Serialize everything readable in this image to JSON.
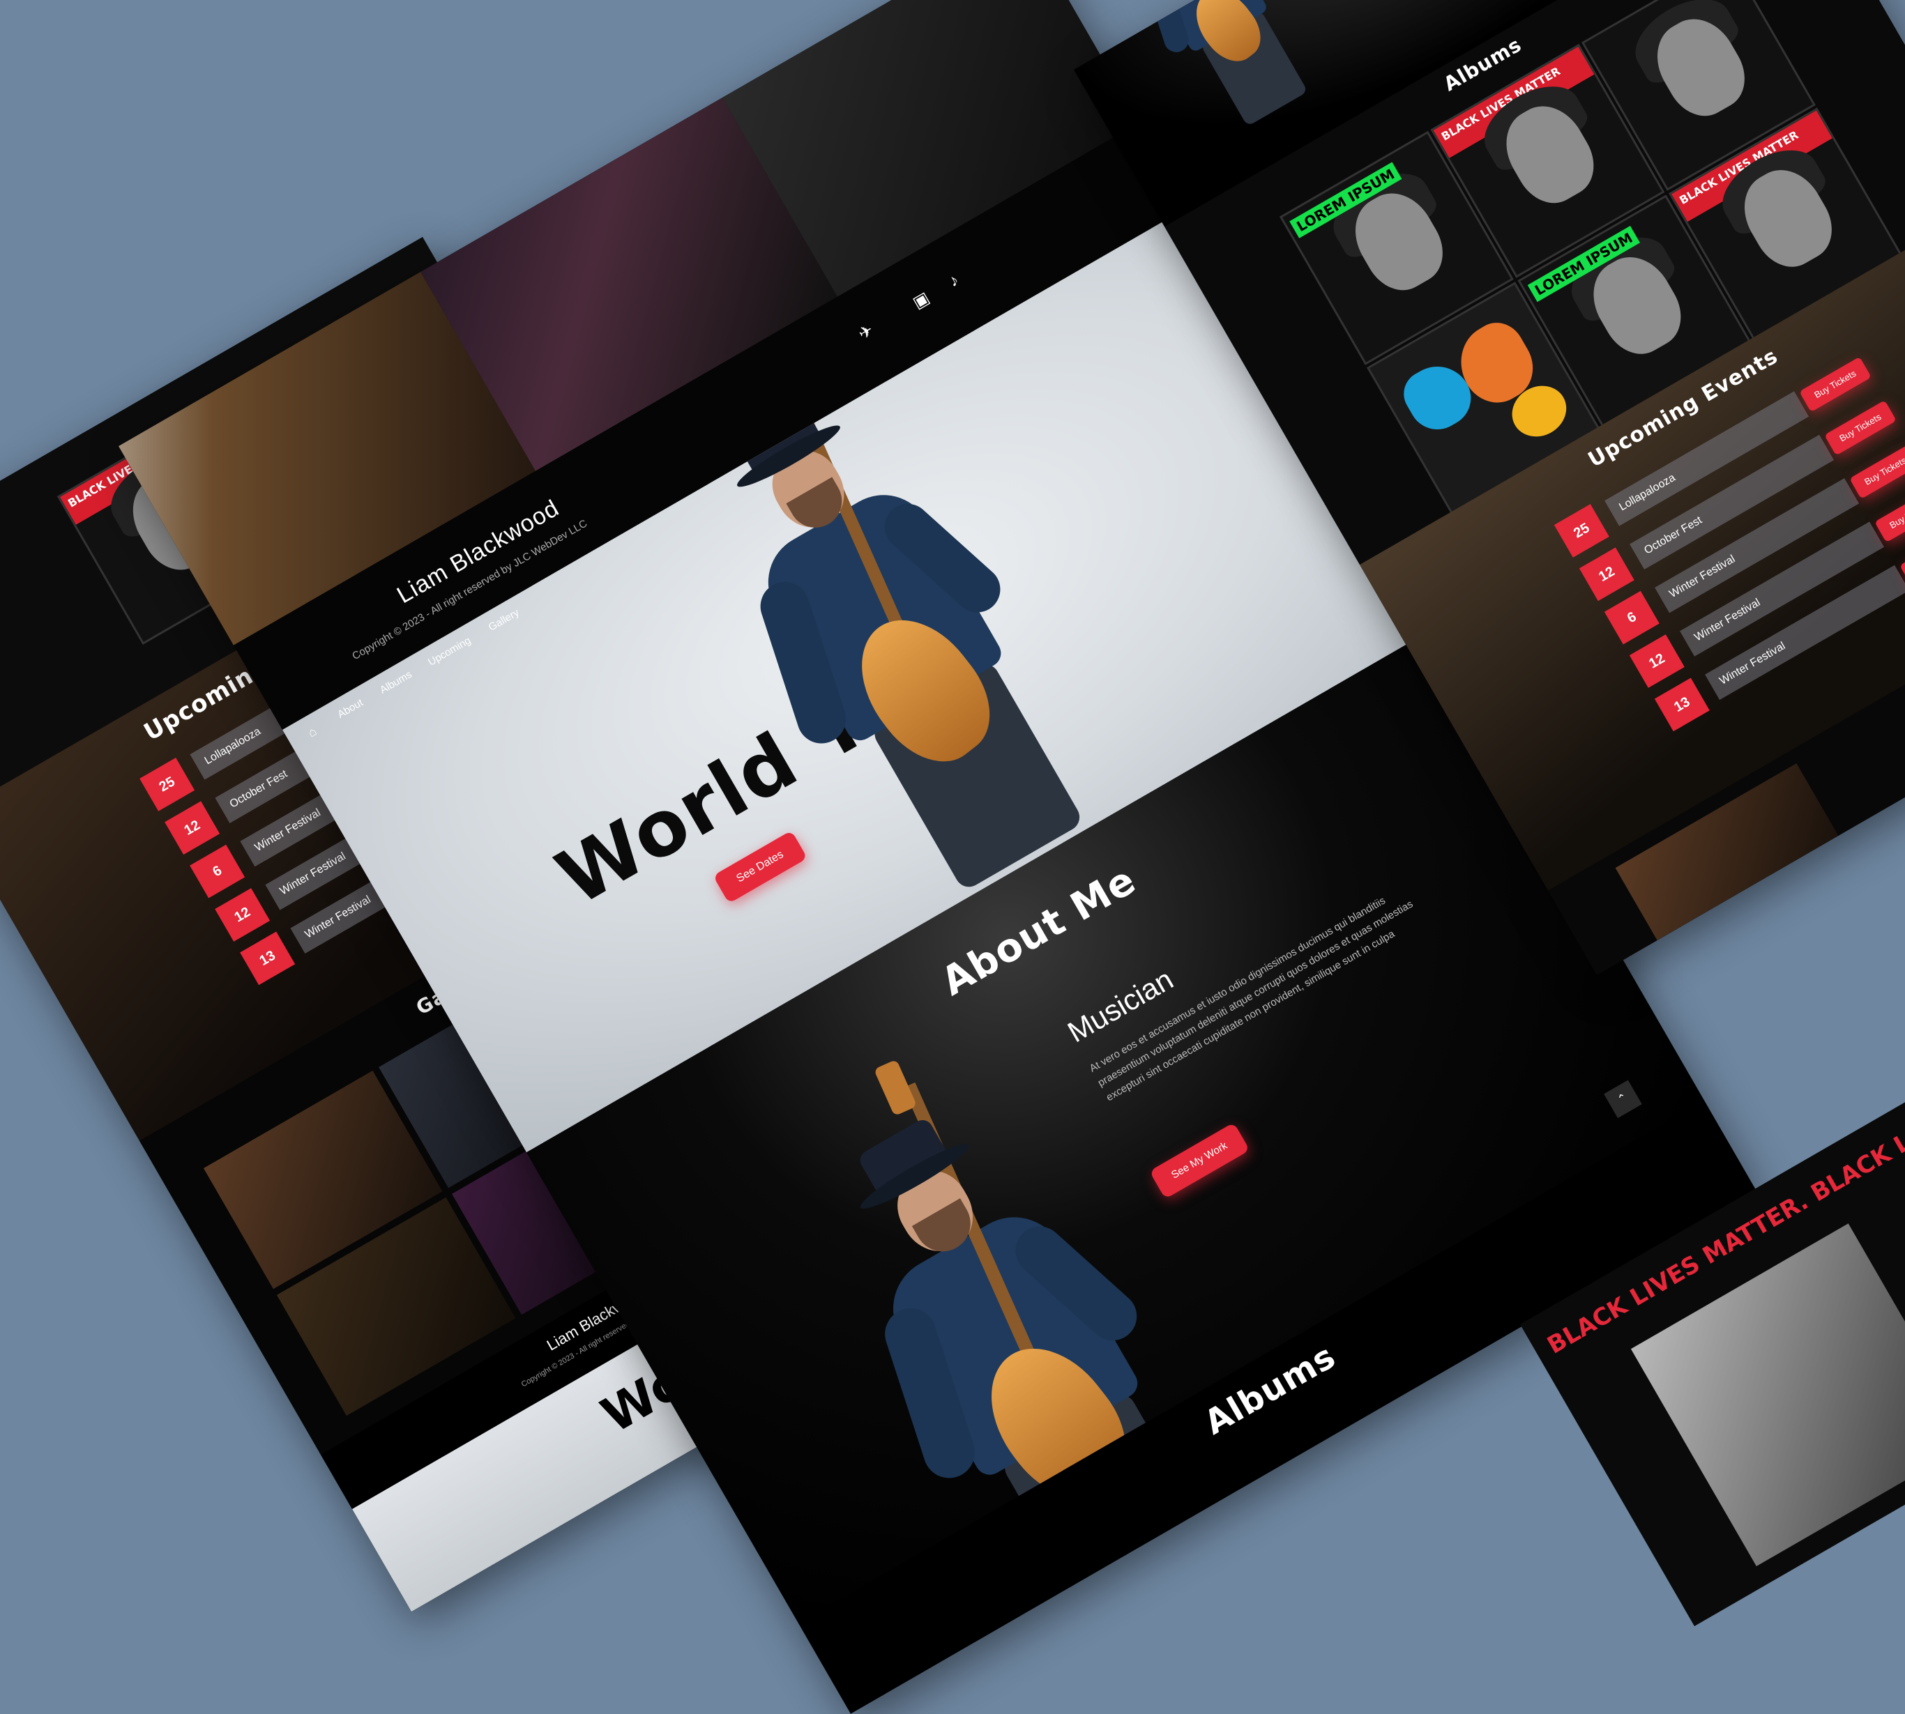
{
  "site": {
    "artist_name": "Liam Blackwood",
    "copyright": "Copyright © 2023 - All right reserved by JLC WebDev LLC",
    "nav": [
      "About",
      "Albums",
      "Upcoming",
      "Gallery"
    ],
    "social_icons": [
      "home-icon",
      "twitter-icon",
      "tiktok-icon",
      "youtube-icon"
    ]
  },
  "hero": {
    "title": "World Tour",
    "button_label": "See Dates"
  },
  "about": {
    "heading": "About Me",
    "subheading": "Musician",
    "body": "At vero eos et accusamus et iusto odio dignissimos ducimus qui blanditiis praesentium voluptatum deleniti atque corrupti quos dolores et quas molestias excepturi sint occaecati cupiditate non provident, similique sunt in culpa",
    "button_label": "See My Work"
  },
  "albums": {
    "heading": "Albums",
    "covers": [
      {
        "tag": "LOREM IPSUM"
      },
      {
        "stripe": "BLACK LIVES MATTER"
      },
      {
        "stripe": "BLACK LIVES MATTER"
      },
      {
        "tag": "LOREM IPSUM"
      }
    ],
    "poster_text": "BLACK LIVES MATTER. BLACK LIVES MATTER. BLACK"
  },
  "events": {
    "heading": "Upcoming Events",
    "buy_label": "Buy Tickets",
    "items": [
      {
        "day": "25",
        "name": "Lollapalooza"
      },
      {
        "day": "12",
        "name": "October Fest"
      },
      {
        "day": "6",
        "name": "Winter Festival"
      },
      {
        "day": "12",
        "name": "Winter Festival"
      },
      {
        "day": "13",
        "name": "Winter Festival"
      }
    ]
  },
  "gallery": {
    "heading": "Gallery"
  },
  "colors": {
    "background": "#6e86a0",
    "accent": "#e5283a",
    "page": "#050505"
  }
}
